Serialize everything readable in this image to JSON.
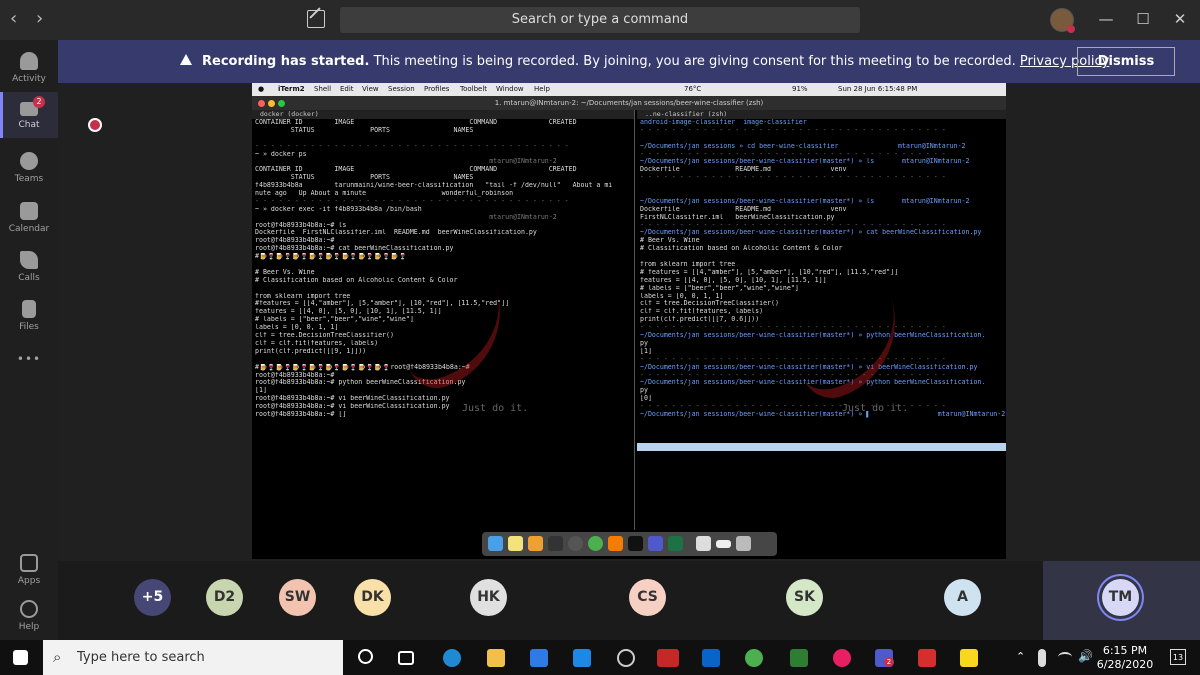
{
  "titlebar": {
    "search_placeholder": "Search or type a command",
    "back_icon": "chevron-left-icon",
    "forward_icon": "chevron-right-icon",
    "compose_icon": "compose-icon",
    "minimize": "—",
    "maximize": "☐",
    "close": "✕"
  },
  "rail": {
    "items": [
      {
        "label": "Activity",
        "icon": "bell-icon"
      },
      {
        "label": "Chat",
        "icon": "chat-icon",
        "badge": "2"
      },
      {
        "label": "Teams",
        "icon": "teams-icon"
      },
      {
        "label": "Calendar",
        "icon": "calendar-icon"
      },
      {
        "label": "Calls",
        "icon": "phone-icon"
      },
      {
        "label": "Files",
        "icon": "file-icon"
      },
      {
        "label": "•••",
        "icon": "more-icon"
      },
      {
        "label": "Apps",
        "icon": "apps-icon"
      },
      {
        "label": "Help",
        "icon": "help-icon"
      }
    ]
  },
  "banner": {
    "bold": "Recording has started.",
    "text": " This meeting is being recorded. By joining, you are giving consent for this meeting to be recorded. ",
    "link": "Privacy policy",
    "dismiss_label": "Dismiss"
  },
  "shared_screen": {
    "menubar": {
      "app": "iTerm2",
      "items": [
        "Shell",
        "Edit",
        "View",
        "Session",
        "Profiles",
        "Toolbelt",
        "Window",
        "Help"
      ],
      "temp": "76°C",
      "battery": "91%",
      "datetime": "Sun 28 Jun  6:15:48 PM"
    },
    "window_title": "1. mtarun@INmtarun-2: ~/Documents/jan sessions/beer-wine-classifier (zsh)",
    "left_tab": "docker (docker)",
    "right_tab": "..ne-classifier (zsh)",
    "left_lines": [
      {
        "t": "CONTAINER ID        IMAGE                             COMMAND             CREATED",
        "c": ""
      },
      {
        "t": "         STATUS              PORTS                NAMES",
        "c": ""
      },
      {
        "t": "",
        "c": ""
      },
      {
        "t": "- - - - - - - - - - - - - - - - - - - - - - - - - - - - - - - - - - - - - - - -",
        "c": "dim"
      },
      {
        "t": "~ » docker ps",
        "c": ""
      },
      {
        "t": "                                                           mtarun@INmtarun-2",
        "c": "dim"
      },
      {
        "t": "CONTAINER ID        IMAGE                             COMMAND             CREATED",
        "c": ""
      },
      {
        "t": "         STATUS              PORTS                NAMES",
        "c": ""
      },
      {
        "t": "f4b8933b4b8a        tarunmaini/wine-beer-classification   \"tail -f /dev/null\"   About a mi",
        "c": ""
      },
      {
        "t": "nute ago   Up About a minute                   wonderful_robinson",
        "c": ""
      },
      {
        "t": "- - - - - - - - - - - - - - - - - - - - - - - - - - - - - - - - - - - - - - - -",
        "c": "dim"
      },
      {
        "t": "~ » docker exec -it f4b8933b4b8a /bin/bash",
        "c": ""
      },
      {
        "t": "                                                           mtarun@INmtarun-2",
        "c": "dim"
      },
      {
        "t": "root@f4b8933b4b8a:~# ls",
        "c": ""
      },
      {
        "t": "Dockerfile  FirstNLClassifier.iml  README.md  beerWineClassification.py",
        "c": ""
      },
      {
        "t": "root@f4b8933b4b8a:~#",
        "c": ""
      },
      {
        "t": "root@f4b8933b4b8a:~# cat beerWineClassification.py",
        "c": ""
      },
      {
        "t": "#🍺🍷🍺🍷🍺🍷🍺🍷🍺🍷🍺🍷🍺🍷🍺🍷🍺🍷",
        "c": ""
      },
      {
        "t": "",
        "c": ""
      },
      {
        "t": "# Beer Vs. Wine",
        "c": ""
      },
      {
        "t": "# Classification based on Alcoholic Content & Color",
        "c": ""
      },
      {
        "t": "",
        "c": ""
      },
      {
        "t": "from sklearn import tree",
        "c": ""
      },
      {
        "t": "#features = [[4,\"amber\"], [5,\"amber\"], [10,\"red\"], [11.5,\"red\"]]",
        "c": ""
      },
      {
        "t": "features = [[4, 0], [5, 0], [10, 1], [11.5, 1]]",
        "c": ""
      },
      {
        "t": "# labels = [\"beer\",\"beer\",\"wine\",\"wine\"]",
        "c": ""
      },
      {
        "t": "labels = [0, 0, 1, 1]",
        "c": ""
      },
      {
        "t": "clf = tree.DecisionTreeClassifier()",
        "c": ""
      },
      {
        "t": "clf = clf.fit(features, labels)",
        "c": ""
      },
      {
        "t": "print(clf.predict([[9, 1]]))",
        "c": ""
      },
      {
        "t": "",
        "c": ""
      },
      {
        "t": "#🍺🍷🍺🍷🍺🍷🍺🍷🍺🍷🍺🍷🍺🍷🍺🍷root@f4b8933b4b8a:~#",
        "c": ""
      },
      {
        "t": "root@f4b8933b4b8a:~#",
        "c": ""
      },
      {
        "t": "root@f4b8933b4b8a:~# python beerWineClassification.py",
        "c": ""
      },
      {
        "t": "[1]",
        "c": ""
      },
      {
        "t": "root@f4b8933b4b8a:~# vi beerWineClassification.py",
        "c": ""
      },
      {
        "t": "root@f4b8933b4b8a:~# vi beerWineClassification.py",
        "c": ""
      },
      {
        "t": "root@f4b8933b4b8a:~# []",
        "c": ""
      }
    ],
    "right_lines": [
      {
        "t": "android-image-classifier  image-classifier",
        "c": "blue"
      },
      {
        "t": "- - - - - - - - - - - - - - - - - - - - - - - - - - - - - - - - - - - - - - -",
        "c": "dim"
      },
      {
        "t": "",
        "c": ""
      },
      {
        "t": "~/Documents/jan sessions » cd beer-wine-classifier               mtarun@INmtarun-2",
        "c": "prompt"
      },
      {
        "t": "- - - - - - - - - - - - - - - - - - - - - - - - - - - - - - - - - - - - - - -",
        "c": "dim"
      },
      {
        "t": "~/Documents/jan sessions/beer-wine-classifier(master*) » ls       mtarun@INmtarun-2",
        "c": "prompt"
      },
      {
        "t": "Dockerfile              README.md               venv",
        "c": ""
      },
      {
        "t": "- - - - - - - - - - - - - - - - - - - - - - - - - - - - - - - - - - - - - - -",
        "c": "dim"
      },
      {
        "t": "",
        "c": ""
      },
      {
        "t": "",
        "c": ""
      },
      {
        "t": "~/Documents/jan sessions/beer-wine-classifier(master*) » ls       mtarun@INmtarun-2",
        "c": "prompt"
      },
      {
        "t": "Dockerfile              README.md               venv",
        "c": ""
      },
      {
        "t": "FirstNLClassifier.iml   beerWineClassification.py",
        "c": ""
      },
      {
        "t": "- - - - - - - - - - - - - - - - - - - - - - - - - - - - - - - - - - - - - - -",
        "c": "dim"
      },
      {
        "t": "~/Documents/jan sessions/beer-wine-classifier(master*) » cat beerWineClassification.py",
        "c": "prompt"
      },
      {
        "t": "# Beer Vs. Wine",
        "c": ""
      },
      {
        "t": "# Classification based on Alcoholic Content & Color",
        "c": ""
      },
      {
        "t": "",
        "c": ""
      },
      {
        "t": "from sklearn import tree",
        "c": ""
      },
      {
        "t": "# features = [[4,\"amber\"], [5,\"amber\"], [10,\"red\"], [11.5,\"red\"]]",
        "c": ""
      },
      {
        "t": "features = [[4, 0], [5, 0], [10, 1], [11.5, 1]]",
        "c": ""
      },
      {
        "t": "# labels = [\"beer\",\"beer\",\"wine\",\"wine\"]",
        "c": ""
      },
      {
        "t": "labels = [0, 0, 1, 1]",
        "c": ""
      },
      {
        "t": "clf = tree.DecisionTreeClassifier()",
        "c": ""
      },
      {
        "t": "clf = clf.fit(features, labels)",
        "c": ""
      },
      {
        "t": "print(clf.predict([[7, 0.6]]))",
        "c": ""
      },
      {
        "t": "- - - - - - - - - - - - - - - - - - - - - - - - - - - - - - - - - - - - - - -",
        "c": "dim"
      },
      {
        "t": "~/Documents/jan sessions/beer-wine-classifier(master*) » python beerWineClassification.",
        "c": "prompt"
      },
      {
        "t": "py",
        "c": ""
      },
      {
        "t": "[1]",
        "c": ""
      },
      {
        "t": "- - - - - - - - - - - - - - - - - - - - - - - - - - - - - - - - - - - - - - -",
        "c": "dim"
      },
      {
        "t": "~/Documents/jan sessions/beer-wine-classifier(master*) » vi beerWineClassification.py",
        "c": "prompt"
      },
      {
        "t": "- - - - - - - - - - - - - - - - - - - - - - - - - - - - - - - - - - - - - - -",
        "c": "dim"
      },
      {
        "t": "~/Documents/jan sessions/beer-wine-classifier(master*) » python beerWineClassification.",
        "c": "prompt"
      },
      {
        "t": "py",
        "c": ""
      },
      {
        "t": "[0]",
        "c": ""
      },
      {
        "t": "- - - - - - - - - - - - - - - - - - - - - - - - - - - - - - - - - - - - - - -",
        "c": "dim"
      },
      {
        "t": "~/Documents/jan sessions/beer-wine-classifier(master*) » ▌                 mtarun@INmtarun-2",
        "c": "prompt"
      },
      {
        "t": "",
        "c": ""
      },
      {
        "t": "",
        "c": ""
      },
      {
        "t": "",
        "c": ""
      },
      {
        "t": " ",
        "c": "sel"
      }
    ],
    "wallpaper_text": "Just do it."
  },
  "participants": [
    {
      "initials": "+5",
      "color": "#464775"
    },
    {
      "initials": "D2",
      "color": "#c8d6b0"
    },
    {
      "initials": "SW",
      "color": "#f2c4b0"
    },
    {
      "initials": "DK",
      "color": "#f8e0a8"
    },
    {
      "initials": "HK",
      "color": "#e0e0e0"
    },
    {
      "initials": "CS",
      "color": "#f7d0c4"
    },
    {
      "initials": "SK",
      "color": "#d4e8c8"
    },
    {
      "initials": "A",
      "color": "#cfe2f0"
    },
    {
      "initials": "TM",
      "color": "#d6d8f5"
    }
  ],
  "taskbar": {
    "search_placeholder": "Type here to search",
    "time": "6:15 PM",
    "date": "6/28/2020",
    "notifications": "13",
    "teams_badge": "2"
  }
}
